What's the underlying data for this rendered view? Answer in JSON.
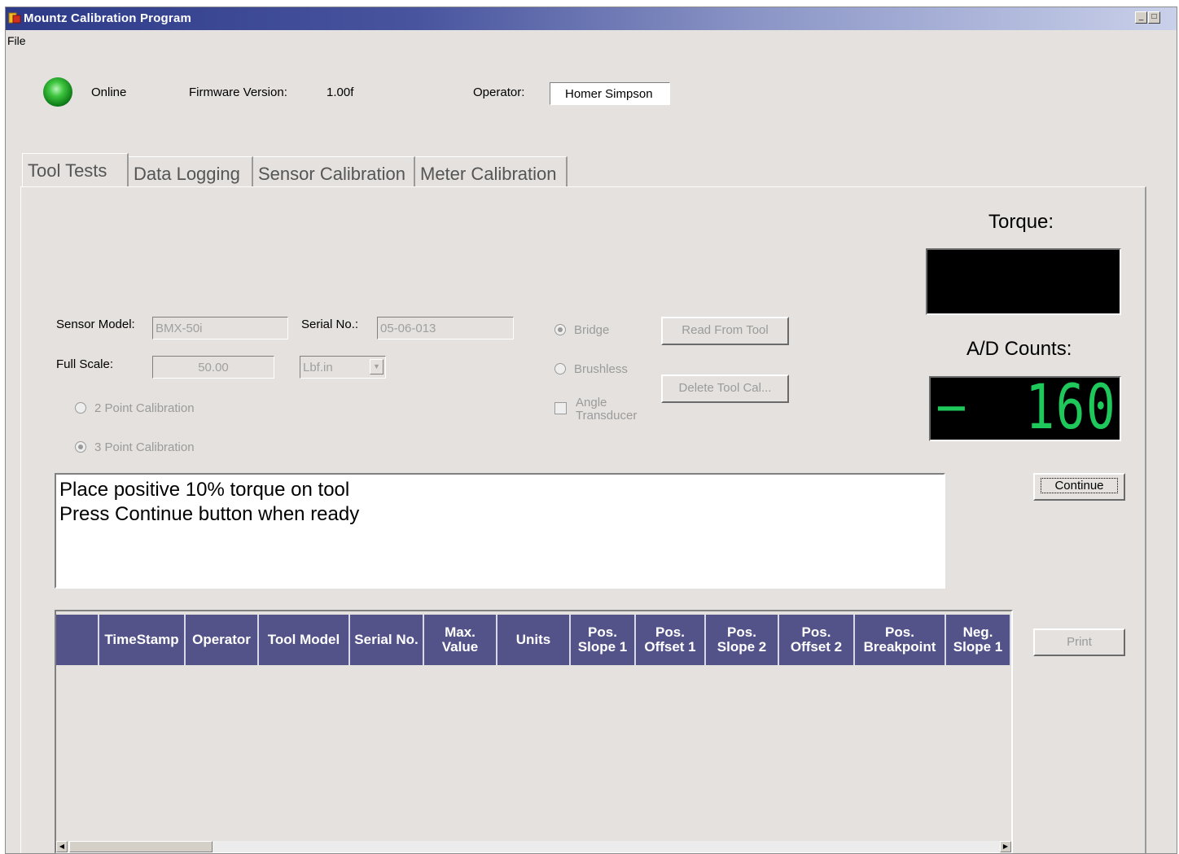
{
  "window": {
    "title": "Mountz Calibration Program",
    "controls": [
      "_",
      "□"
    ]
  },
  "menu": {
    "file": "File"
  },
  "status": {
    "online": "Online",
    "firmware_label": "Firmware Version:",
    "firmware_value": "1.00f",
    "operator_label": "Operator:",
    "operator_value": "Homer Simpson"
  },
  "tabs": [
    "Tool Tests",
    "Data Logging",
    "Sensor Calibration",
    "Meter Calibration"
  ],
  "form": {
    "sensor_model_label": "Sensor Model:",
    "sensor_model_value": "BMX-50i",
    "serial_label": "Serial No.:",
    "serial_value": "05-06-013",
    "full_scale_label": "Full Scale:",
    "full_scale_value": "50.00",
    "units_value": "Lbf.in",
    "two_point": "2 Point Calibration",
    "three_point": "3 Point Calibration",
    "bridge": "Bridge",
    "brushless": "Brushless",
    "angle_line1": "Angle",
    "angle_line2": "Transducer",
    "read_from_tool": "Read From Tool",
    "delete_tool_cal": "Delete Tool Cal..."
  },
  "torque": {
    "label": "Torque:",
    "value": ""
  },
  "ad_counts": {
    "label": "A/D Counts:",
    "sign": "−",
    "value": "160"
  },
  "message": {
    "line1": "Place positive 10% torque on tool",
    "line2": "Press Continue button when ready"
  },
  "buttons": {
    "continue": "Continue",
    "print": "Print"
  },
  "grid": {
    "columns": [
      "TimeStamp",
      "Operator",
      "Tool Model",
      "Serial No.",
      "Max.\nValue",
      "Units",
      "Pos.\nSlope 1",
      "Pos.\nOffset 1",
      "Pos.\nSlope 2",
      "Pos.\nOffset 2",
      "Pos.\nBreakpoint",
      "Neg.\nSlope 1"
    ],
    "rows": []
  },
  "colors": {
    "header_bg": "#535289",
    "display_digit": "#1ec85a",
    "led": "#3fc63f"
  }
}
